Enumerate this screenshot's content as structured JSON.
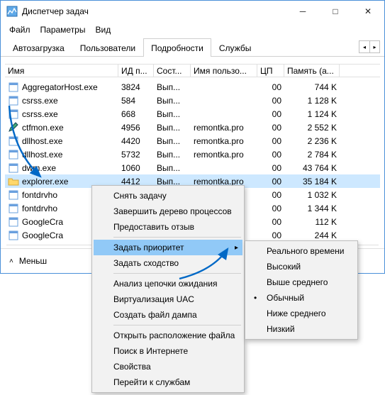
{
  "title": "Диспетчер задач",
  "menu": [
    "Файл",
    "Параметры",
    "Вид"
  ],
  "tabs": [
    "Автозагрузка",
    "Пользователи",
    "Подробности",
    "Службы"
  ],
  "activeTab": 2,
  "columns": [
    "Имя",
    "ИД п...",
    "Сост...",
    "Имя пользо...",
    "ЦП",
    "Память (а..."
  ],
  "rows": [
    {
      "icon": "app",
      "name": "AggregatorHost.exe",
      "pid": "3824",
      "state": "Вып...",
      "user": "",
      "cpu": "00",
      "mem": "744 K"
    },
    {
      "icon": "app",
      "name": "csrss.exe",
      "pid": "584",
      "state": "Вып...",
      "user": "",
      "cpu": "00",
      "mem": "1 128 K"
    },
    {
      "icon": "app",
      "name": "csrss.exe",
      "pid": "668",
      "state": "Вып...",
      "user": "",
      "cpu": "00",
      "mem": "1 124 K"
    },
    {
      "icon": "pen",
      "name": "ctfmon.exe",
      "pid": "4956",
      "state": "Вып...",
      "user": "remontka.pro",
      "cpu": "00",
      "mem": "2 552 K"
    },
    {
      "icon": "app",
      "name": "dllhost.exe",
      "pid": "4420",
      "state": "Вып...",
      "user": "remontka.pro",
      "cpu": "00",
      "mem": "2 236 K"
    },
    {
      "icon": "app",
      "name": "dllhost.exe",
      "pid": "5732",
      "state": "Вып...",
      "user": "remontka.pro",
      "cpu": "00",
      "mem": "2 784 K"
    },
    {
      "icon": "app",
      "name": "dwm.exe",
      "pid": "1060",
      "state": "Вып...",
      "user": "",
      "cpu": "00",
      "mem": "43 764 K"
    },
    {
      "icon": "folder",
      "name": "explorer.exe",
      "pid": "4412",
      "state": "Вып...",
      "user": "remontka.pro",
      "cpu": "00",
      "mem": "35 184 K",
      "sel": true
    },
    {
      "icon": "app",
      "name": "fontdrvho",
      "pid": "",
      "state": "",
      "user": "",
      "cpu": "00",
      "mem": "1 032 K"
    },
    {
      "icon": "app",
      "name": "fontdrvho",
      "pid": "",
      "state": "",
      "user": "",
      "cpu": "00",
      "mem": "1 344 K"
    },
    {
      "icon": "app",
      "name": "GoogleCra",
      "pid": "",
      "state": "",
      "user": "",
      "cpu": "00",
      "mem": "112 K"
    },
    {
      "icon": "app",
      "name": "GoogleCra",
      "pid": "",
      "state": "",
      "user": "",
      "cpu": "00",
      "mem": "244 K"
    }
  ],
  "footer": {
    "less": "Меньш"
  },
  "ctxMenu": [
    {
      "t": "Снять задачу"
    },
    {
      "t": "Завершить дерево процессов"
    },
    {
      "t": "Предоставить отзыв"
    },
    {
      "sep": true
    },
    {
      "t": "Задать приоритет",
      "sub": true,
      "hov": true
    },
    {
      "t": "Задать сходство"
    },
    {
      "sep": true
    },
    {
      "t": "Анализ цепочки ожидания"
    },
    {
      "t": "Виртуализация UAC"
    },
    {
      "t": "Создать файл дампа"
    },
    {
      "sep": true
    },
    {
      "t": "Открыть расположение файла"
    },
    {
      "t": "Поиск в Интернете"
    },
    {
      "t": "Свойства"
    },
    {
      "t": "Перейти к службам"
    }
  ],
  "subMenu": [
    {
      "t": "Реального времени"
    },
    {
      "t": "Высокий"
    },
    {
      "t": "Выше среднего"
    },
    {
      "t": "Обычный",
      "dot": true
    },
    {
      "t": "Ниже среднего"
    },
    {
      "t": "Низкий"
    }
  ]
}
